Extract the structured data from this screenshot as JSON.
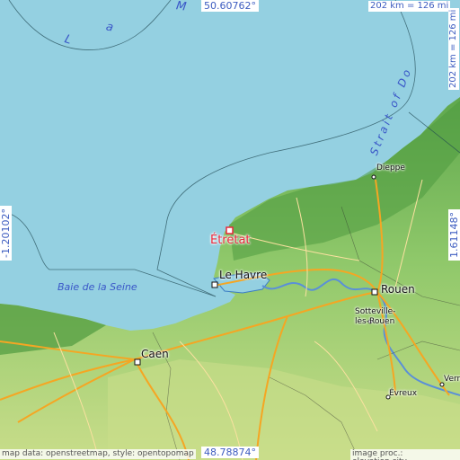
{
  "highlight_city": {
    "label": "Étretat",
    "color": "#e8283c"
  },
  "cities": {
    "le_havre": "Le Havre",
    "rouen": "Rouen",
    "caen": "Caen",
    "dieppe": "Dieppe",
    "sotteville": "Sotteville-lès-Rouen",
    "evreux": "Évreux",
    "verneuil": "Vern"
  },
  "water_labels": {
    "baie": "Baie de la Seine",
    "la_manche_chars": [
      "L",
      "a",
      "M"
    ],
    "strait": "Strait of Do"
  },
  "coordinates": {
    "top": "50.60762°",
    "bottom": "48.78874°",
    "left": "-1.20102°",
    "right": "1.61148°"
  },
  "scale": {
    "top": "202 km = 126 mi",
    "right": "202 km = 126 mi"
  },
  "credits": {
    "left": "map data: openstreetmap, style: opentopomap",
    "right": "image proc.: elevation.city"
  },
  "colors": {
    "sea": "#94d0e1",
    "land": "#8fc86a",
    "highlight": "#e8283c",
    "roads": "#f5a623"
  }
}
